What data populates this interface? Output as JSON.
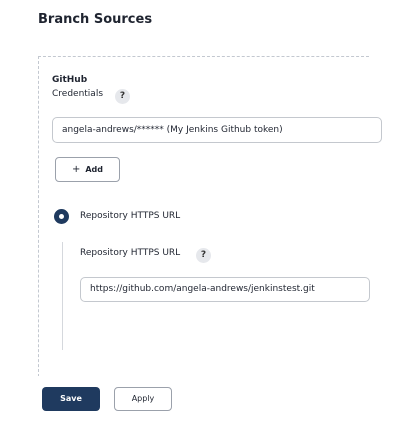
{
  "section": {
    "title": "Branch Sources"
  },
  "source": {
    "name": "GitHub",
    "credentials_label": "Credentials",
    "help_glyph": "?",
    "credentials_value": "angela-andrews/****** (My Jenkins Github token)",
    "add_plus": "+",
    "add_label": "Add",
    "radio_label": "Repository HTTPS URL",
    "url_label": "Repository HTTPS URL",
    "url_value": "https://github.com/angela-andrews/jenkinstest.git"
  },
  "actions": {
    "save_label": "Save",
    "apply_label": "Apply"
  },
  "colors": {
    "primary": "#1f3a5f",
    "border": "#c4c8ce",
    "help_bg": "#e6e8ec"
  },
  "icons": {
    "help": "question-mark-icon",
    "radio": "radio-selected-icon"
  }
}
